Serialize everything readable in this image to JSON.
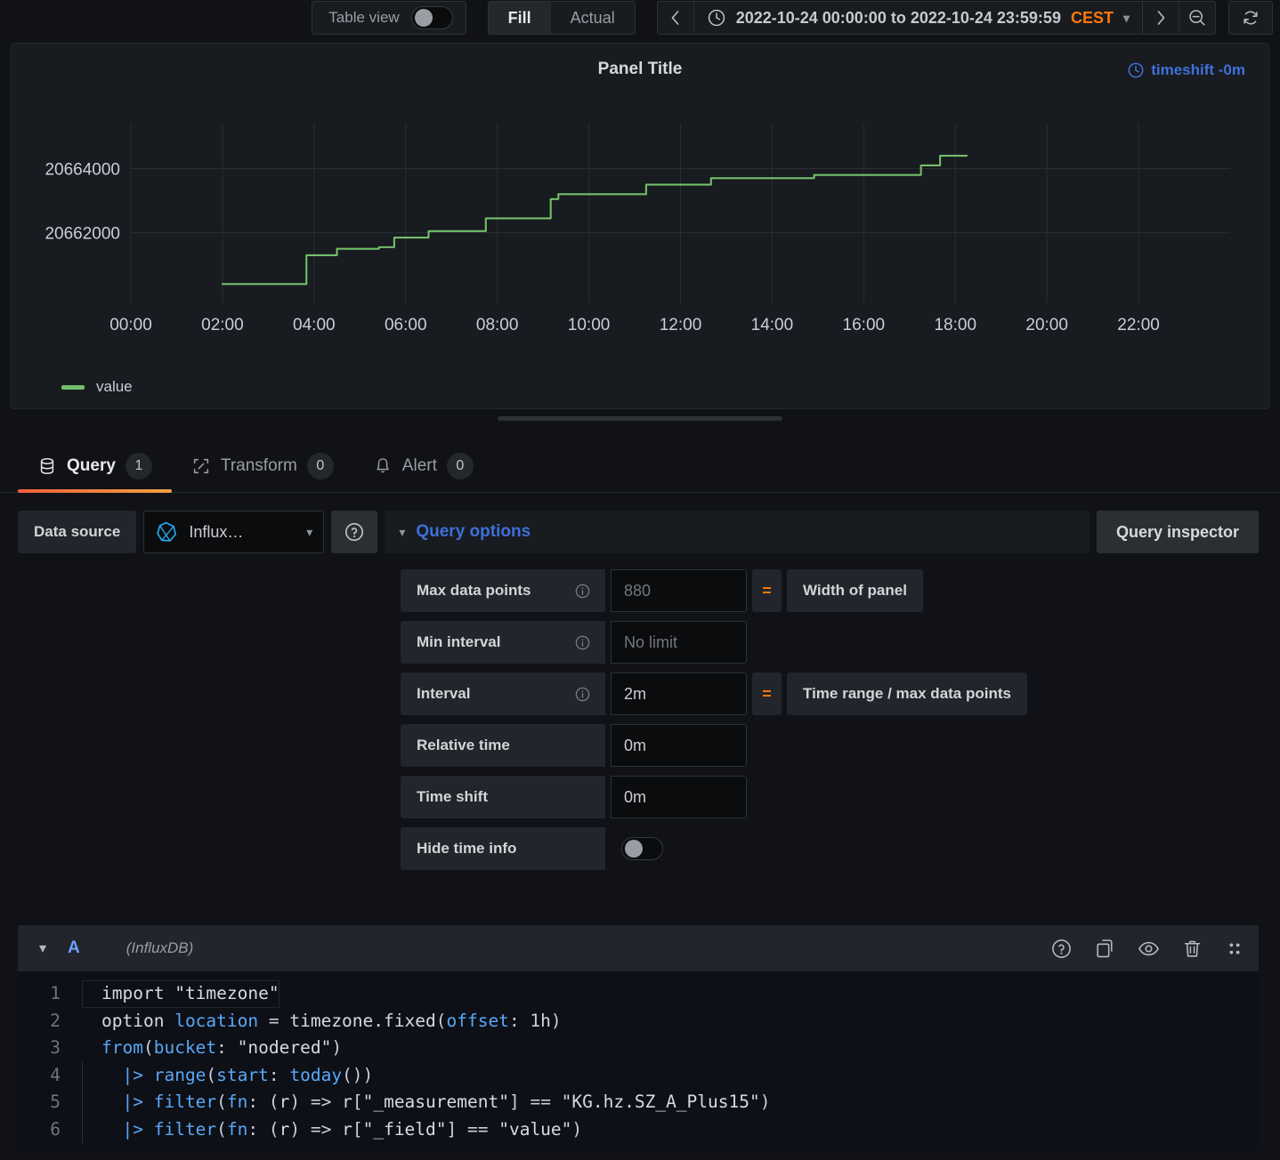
{
  "toolbar": {
    "table_view_label": "Table view",
    "table_view_on": false,
    "fill_label": "Fill",
    "actual_label": "Actual",
    "prev_icon": "chevron-left-icon",
    "clock_icon": "clock-icon",
    "time_range": "2022-10-24 00:00:00 to 2022-10-24 23:59:59",
    "timezone": "CEST",
    "next_icon": "chevron-right-icon",
    "zoom_out_icon": "zoom-out-icon",
    "refresh_icon": "refresh-icon"
  },
  "panel": {
    "title": "Panel Title",
    "timeshift_label": "timeshift -0m",
    "legend": [
      {
        "label": "value",
        "color": "#73bf69"
      }
    ]
  },
  "chart_data": {
    "type": "line",
    "title": "Panel Title",
    "xlabel": "",
    "ylabel": "",
    "grid": true,
    "legend_position": "bottom-left",
    "series": [
      {
        "name": "value",
        "color": "#73bf69",
        "step": "after",
        "x": [
          "02:00",
          "03:50",
          "04:30",
          "05:25",
          "05:45",
          "06:30",
          "07:45",
          "09:10",
          "09:20",
          "11:15",
          "12:40",
          "14:55",
          "17:15",
          "17:40",
          "18:15"
        ],
        "values": [
          20660400,
          20661300,
          20661500,
          20661550,
          20661850,
          20662050,
          20662450,
          20663050,
          20663200,
          20663500,
          20663700,
          20663800,
          20664100,
          20664400,
          20664400
        ]
      }
    ],
    "ytick_labels": [
      "20664000",
      "20662000"
    ],
    "ytick_values": [
      20664000,
      20662000
    ],
    "ylim": [
      20659800,
      20665400
    ],
    "xtick_labels": [
      "00:00",
      "02:00",
      "04:00",
      "06:00",
      "08:00",
      "10:00",
      "12:00",
      "14:00",
      "16:00",
      "18:00",
      "20:00",
      "22:00"
    ],
    "xlim": [
      "00:00",
      "23:59"
    ]
  },
  "tabs": [
    {
      "label": "Query",
      "count": "1",
      "icon": "database-icon",
      "active": true
    },
    {
      "label": "Transform",
      "count": "0",
      "icon": "transform-icon",
      "active": false
    },
    {
      "label": "Alert",
      "count": "0",
      "icon": "bell-icon",
      "active": false
    }
  ],
  "query_header": {
    "data_source_label": "Data source",
    "data_source_value": "Influx…",
    "data_source_icon": "influxdb-icon",
    "help_icon": "question-circle-icon",
    "query_options_label": "Query options",
    "query_inspector_label": "Query inspector"
  },
  "query_options": [
    {
      "label": "Max data points",
      "info": true,
      "value": "880",
      "placeholder": "",
      "is_placeholder": true,
      "eq": "=",
      "desc": "Width of panel"
    },
    {
      "label": "Min interval",
      "info": true,
      "value": "No limit",
      "placeholder": "No limit",
      "is_placeholder": true,
      "eq": "",
      "desc": ""
    },
    {
      "label": "Interval",
      "info": true,
      "value": "2m",
      "placeholder": "",
      "is_placeholder": false,
      "eq": "=",
      "desc": "Time range / max data points"
    },
    {
      "label": "Relative time",
      "info": false,
      "value": "0m",
      "placeholder": "",
      "is_placeholder": false,
      "eq": "",
      "desc": ""
    },
    {
      "label": "Time shift",
      "info": false,
      "value": "0m",
      "placeholder": "",
      "is_placeholder": false,
      "eq": "",
      "desc": ""
    },
    {
      "label": "Hide time info",
      "info": false,
      "toggle": true,
      "toggle_on": false
    }
  ],
  "query_row": {
    "ref_id": "A",
    "datasource_name": "(InfluxDB)",
    "collapse_icon": "chevron-down-icon",
    "icons": [
      "question-circle-icon",
      "copy-icon",
      "eye-icon",
      "trash-icon",
      "drag-handle-icon"
    ]
  },
  "code_editor": {
    "lines": [
      {
        "n": "1",
        "text": "import \"timezone\""
      },
      {
        "n": "2",
        "text": "option location = timezone.fixed(offset: 1h)"
      },
      {
        "n": "3",
        "text": "from(bucket: \"nodered\")"
      },
      {
        "n": "4",
        "text": "  |> range(start: today())"
      },
      {
        "n": "5",
        "text": "  |> filter(fn: (r) => r[\"_measurement\"] == \"KG.hz.SZ_A_Plus15\")"
      },
      {
        "n": "6",
        "text": "  |> filter(fn: (r) => r[\"_field\"] == \"value\")"
      }
    ]
  },
  "colors": {
    "accent_orange": "#ff780a",
    "accent_blue": "#3d71d9",
    "series_green": "#73bf69",
    "panel_bg": "#181b1f",
    "page_bg": "#111217"
  }
}
